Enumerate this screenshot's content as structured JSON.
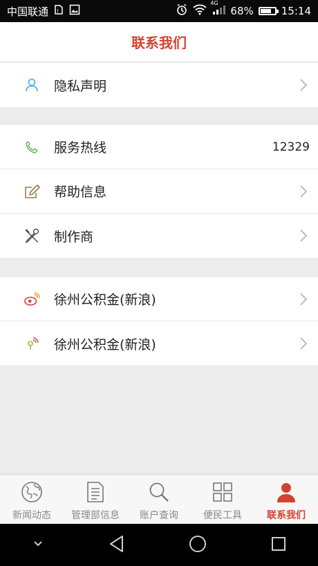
{
  "status_bar": {
    "carrier": "中国联通",
    "network": "4G",
    "battery": "68%",
    "battery_level": 0.68,
    "time": "15:14"
  },
  "header": {
    "title": "联系我们"
  },
  "groups": [
    {
      "items": [
        {
          "label": "隐私声明",
          "icon": "user-icon",
          "chevron": true
        }
      ]
    },
    {
      "items": [
        {
          "label": "服务热线",
          "icon": "phone-icon",
          "value": "12329"
        },
        {
          "label": "帮助信息",
          "icon": "edit-icon",
          "chevron": true
        },
        {
          "label": "制作商",
          "icon": "tools-icon",
          "chevron": true
        }
      ]
    },
    {
      "items": [
        {
          "label": "徐州公积金(新浪)",
          "icon": "weibo-icon",
          "chevron": true
        },
        {
          "label": "徐州公积金(新浪)",
          "icon": "tencent-weibo-icon",
          "chevron": true
        }
      ]
    }
  ],
  "tabs": [
    {
      "label": "新闻动态",
      "icon": "globe-icon",
      "active": false
    },
    {
      "label": "管理部信息",
      "icon": "document-icon",
      "active": false
    },
    {
      "label": "账户查询",
      "icon": "search-icon",
      "active": false
    },
    {
      "label": "便民工具",
      "icon": "grid-icon",
      "active": false
    },
    {
      "label": "联系我们",
      "icon": "person-icon",
      "active": true
    }
  ],
  "colors": {
    "accent": "#d2432f",
    "icon_blue": "#4aa8e8",
    "icon_green": "#5cb85c",
    "icon_brown": "#9a7a4e",
    "background": "#ececec"
  }
}
